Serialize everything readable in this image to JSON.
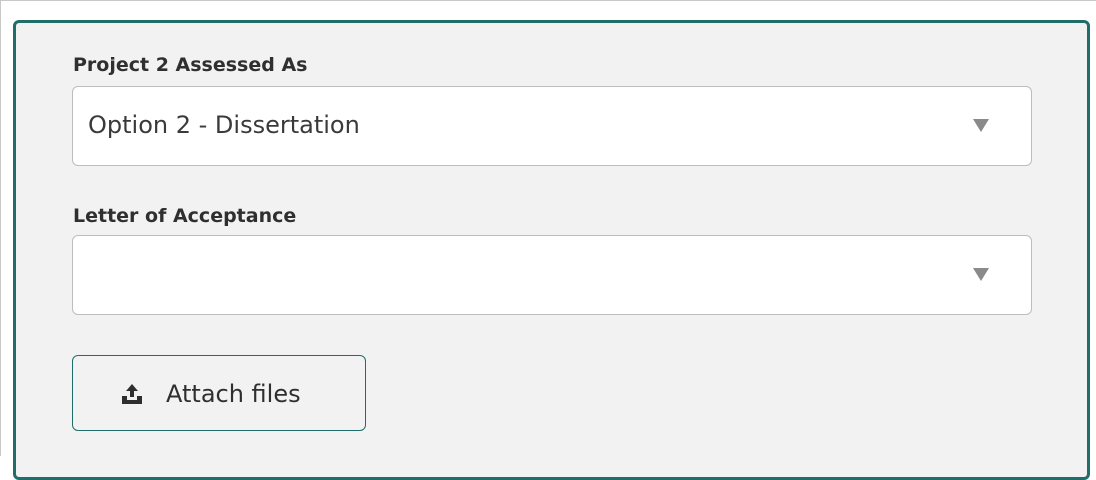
{
  "form": {
    "project_assessment": {
      "label": "Project 2 Assessed As",
      "value": "Option 2 - Dissertation"
    },
    "letter_of_acceptance": {
      "label": "Letter of Acceptance",
      "value": ""
    },
    "attach_button": {
      "label": "Attach files",
      "icon": "upload-icon"
    }
  },
  "colors": {
    "panel_border": "#1f6e6a",
    "panel_background": "#f2f2f2",
    "field_background": "#ffffff",
    "text": "#2f2f2f"
  }
}
